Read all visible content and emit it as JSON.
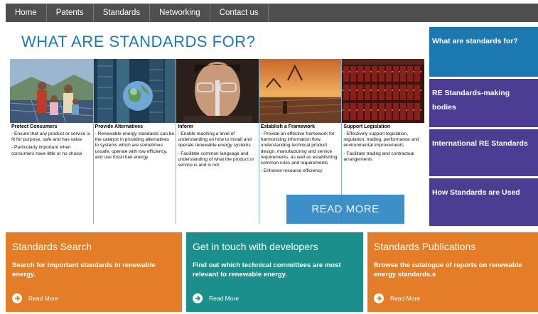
{
  "nav": {
    "items": [
      "Home",
      "Patents",
      "Standards",
      "Networking",
      "Contact us"
    ]
  },
  "hero": {
    "title": "WHAT ARE STANDARDS FOR?",
    "read_more": "READ MORE",
    "columns": [
      {
        "title": "Protect Consumers",
        "points": [
          "- Ensure that any product or service is fit for purpose, safe and has value",
          "- Particularly important when consumers have little or no choice"
        ]
      },
      {
        "title": "Provide Alternatives",
        "points": [
          "- Renewable energy standards can be the catalyst in providing alternatives to systems which are sometimes unsafe, operate with low efficiency, and use fossil fuel energy"
        ]
      },
      {
        "title": "Inform",
        "points": [
          "- Enable reaching a level of understanding on how to install and operate renewable energy systems",
          "- Facilitate common language and understanding of what the product or service is and is not"
        ]
      },
      {
        "title": "Establish a Framework",
        "points": [
          "- Provide an effective framework for harmonizing information flow, understanding technical product design, manufacturing and service requirements, as well as establishing common rules and requirements",
          "- Enhance resource efficiency"
        ]
      },
      {
        "title": "Support Legislation",
        "points": [
          "- Effectively support legislation, regulation, trading, performance and environmental improvements",
          "- Facilitate trading and contractual arrangements"
        ]
      }
    ]
  },
  "sidebar": {
    "items": [
      {
        "label": "What are standards for?"
      },
      {
        "label": "RE Standards-making bodies"
      },
      {
        "label": "International RE Standards"
      },
      {
        "label": "How Standards are Used"
      }
    ]
  },
  "tiles": [
    {
      "title": "Standards Search",
      "text": "Search for important standards in renewable energy.",
      "link": "Read More"
    },
    {
      "title": "Get in touch with developers",
      "text": "Find out which technical committees are most relevant to renewable energy.",
      "link": "Read More"
    },
    {
      "title": "Standards Publications",
      "text": "Browse the catalogue of reports on renewable energy standards.s",
      "link": "Read More"
    }
  ],
  "colors": {
    "nav_bg": "#4f4f4f",
    "title_blue": "#1b7ab4",
    "sidebar_active": "#1b78b0",
    "sidebar_purple": "#4b3e92",
    "tile_orange": "#e47d27",
    "tile_teal": "#1a8f8b"
  }
}
